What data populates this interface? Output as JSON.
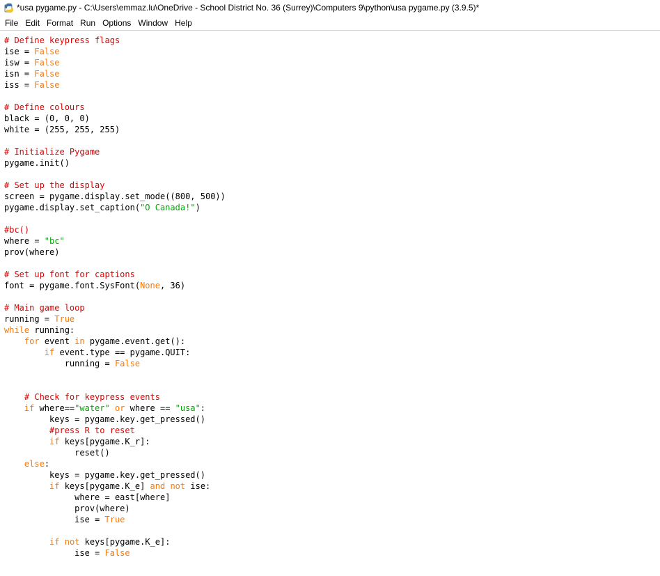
{
  "window": {
    "title": "*usa pygame.py - C:\\Users\\emmaz.lu\\OneDrive - School District No. 36 (Surrey)\\Computers 9\\python\\usa pygame.py (3.9.5)*",
    "icon": "python-idle-icon"
  },
  "menu": [
    "File",
    "Edit",
    "Format",
    "Run",
    "Options",
    "Window",
    "Help"
  ],
  "colors": {
    "comment": "#dd0000",
    "keyword": "#ff7700",
    "string": "#00aa00",
    "text": "#000000"
  },
  "code_lines": [
    [
      {
        "t": "# Define keypress flags",
        "c": "comment"
      }
    ],
    [
      {
        "t": "ise = ",
        "c": "plain"
      },
      {
        "t": "False",
        "c": "keyword"
      }
    ],
    [
      {
        "t": "isw = ",
        "c": "plain"
      },
      {
        "t": "False",
        "c": "keyword"
      }
    ],
    [
      {
        "t": "isn = ",
        "c": "plain"
      },
      {
        "t": "False",
        "c": "keyword"
      }
    ],
    [
      {
        "t": "iss = ",
        "c": "plain"
      },
      {
        "t": "False",
        "c": "keyword"
      }
    ],
    [],
    [
      {
        "t": "# Define colours",
        "c": "comment"
      }
    ],
    [
      {
        "t": "black = (0, 0, 0)",
        "c": "plain"
      }
    ],
    [
      {
        "t": "white = (255, 255, 255)",
        "c": "plain"
      }
    ],
    [],
    [
      {
        "t": "# Initialize Pygame",
        "c": "comment"
      }
    ],
    [
      {
        "t": "pygame.init()",
        "c": "plain"
      }
    ],
    [],
    [
      {
        "t": "# Set up the display",
        "c": "comment"
      }
    ],
    [
      {
        "t": "screen = pygame.display.set_mode((800, 500))",
        "c": "plain"
      }
    ],
    [
      {
        "t": "pygame.display.set_caption(",
        "c": "plain"
      },
      {
        "t": "\"O Canada!\"",
        "c": "string"
      },
      {
        "t": ")",
        "c": "plain"
      }
    ],
    [],
    [
      {
        "t": "#bc()",
        "c": "comment"
      }
    ],
    [
      {
        "t": "where = ",
        "c": "plain"
      },
      {
        "t": "\"bc\"",
        "c": "string"
      }
    ],
    [
      {
        "t": "prov(where)",
        "c": "plain"
      }
    ],
    [],
    [
      {
        "t": "# Set up font for captions",
        "c": "comment"
      }
    ],
    [
      {
        "t": "font = pygame.font.SysFont(",
        "c": "plain"
      },
      {
        "t": "None",
        "c": "keyword"
      },
      {
        "t": ", 36)",
        "c": "plain"
      }
    ],
    [],
    [
      {
        "t": "# Main game loop",
        "c": "comment"
      }
    ],
    [
      {
        "t": "running = ",
        "c": "plain"
      },
      {
        "t": "True",
        "c": "keyword"
      }
    ],
    [
      {
        "t": "while",
        "c": "keyword"
      },
      {
        "t": " running:",
        "c": "plain"
      }
    ],
    [
      {
        "t": "    ",
        "c": "plain"
      },
      {
        "t": "for",
        "c": "keyword"
      },
      {
        "t": " event ",
        "c": "plain"
      },
      {
        "t": "in",
        "c": "keyword"
      },
      {
        "t": " pygame.event.get():",
        "c": "plain"
      }
    ],
    [
      {
        "t": "        ",
        "c": "plain"
      },
      {
        "t": "if",
        "c": "keyword"
      },
      {
        "t": " event.type == pygame.QUIT:",
        "c": "plain"
      }
    ],
    [
      {
        "t": "            running = ",
        "c": "plain"
      },
      {
        "t": "False",
        "c": "keyword"
      }
    ],
    [],
    [],
    [
      {
        "t": "    ",
        "c": "plain"
      },
      {
        "t": "# Check for keypress events",
        "c": "comment"
      }
    ],
    [
      {
        "t": "    ",
        "c": "plain"
      },
      {
        "t": "if",
        "c": "keyword"
      },
      {
        "t": " where==",
        "c": "plain"
      },
      {
        "t": "\"water\"",
        "c": "string"
      },
      {
        "t": " ",
        "c": "plain"
      },
      {
        "t": "or",
        "c": "keyword"
      },
      {
        "t": " where == ",
        "c": "plain"
      },
      {
        "t": "\"usa\"",
        "c": "string"
      },
      {
        "t": ":",
        "c": "plain"
      }
    ],
    [
      {
        "t": "         keys = pygame.key.get_pressed()",
        "c": "plain"
      }
    ],
    [
      {
        "t": "         ",
        "c": "plain"
      },
      {
        "t": "#press R to reset",
        "c": "comment"
      }
    ],
    [
      {
        "t": "         ",
        "c": "plain"
      },
      {
        "t": "if",
        "c": "keyword"
      },
      {
        "t": " keys[pygame.K_r]:",
        "c": "plain"
      }
    ],
    [
      {
        "t": "              reset()",
        "c": "plain"
      }
    ],
    [
      {
        "t": "    ",
        "c": "plain"
      },
      {
        "t": "else",
        "c": "keyword"
      },
      {
        "t": ":",
        "c": "plain"
      }
    ],
    [
      {
        "t": "         keys = pygame.key.get_pressed()",
        "c": "plain"
      }
    ],
    [
      {
        "t": "         ",
        "c": "plain"
      },
      {
        "t": "if",
        "c": "keyword"
      },
      {
        "t": " keys[pygame.K_e] ",
        "c": "plain"
      },
      {
        "t": "and",
        "c": "keyword"
      },
      {
        "t": " ",
        "c": "plain"
      },
      {
        "t": "not",
        "c": "keyword"
      },
      {
        "t": " ise:",
        "c": "plain"
      }
    ],
    [
      {
        "t": "              where = east[where]",
        "c": "plain"
      }
    ],
    [
      {
        "t": "              prov(where)",
        "c": "plain"
      }
    ],
    [
      {
        "t": "              ise = ",
        "c": "plain"
      },
      {
        "t": "True",
        "c": "keyword"
      }
    ],
    [],
    [
      {
        "t": "         ",
        "c": "plain"
      },
      {
        "t": "if",
        "c": "keyword"
      },
      {
        "t": " ",
        "c": "plain"
      },
      {
        "t": "not",
        "c": "keyword"
      },
      {
        "t": " keys[pygame.K_e]:",
        "c": "plain"
      }
    ],
    [
      {
        "t": "              ise = ",
        "c": "plain"
      },
      {
        "t": "False",
        "c": "keyword"
      }
    ]
  ]
}
